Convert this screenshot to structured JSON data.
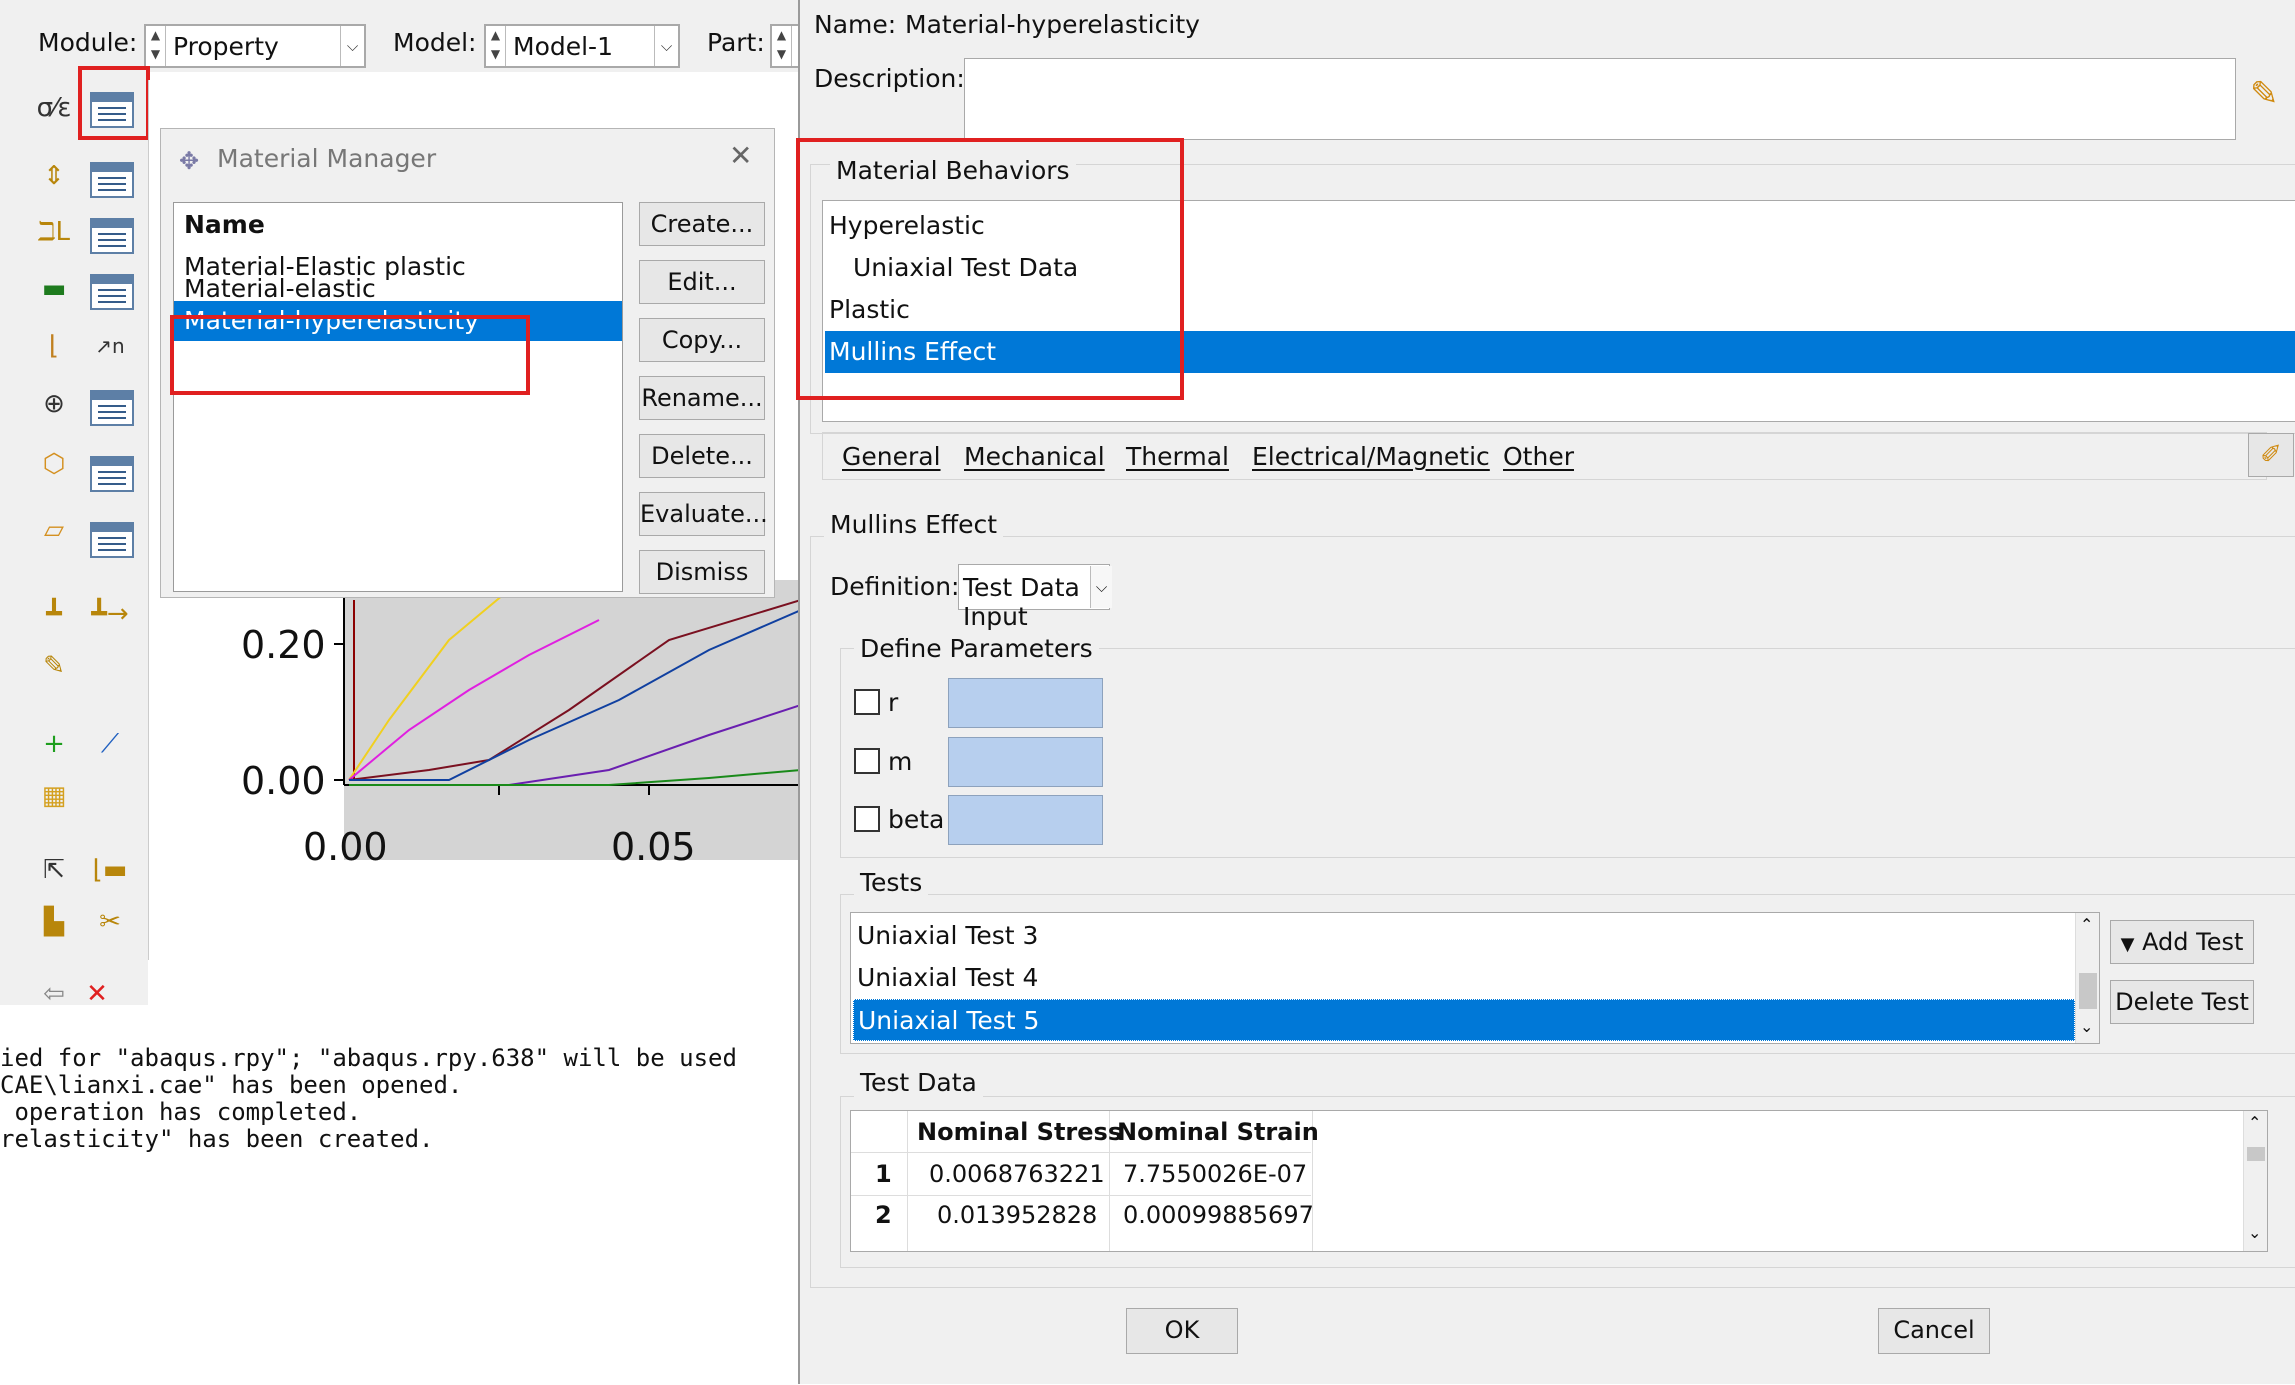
{
  "main": {
    "module_label": "Module:",
    "module_value": "Property",
    "model_label": "Model:",
    "model_value": "Model-1",
    "part_label": "Part:",
    "plot": {
      "y_ticks": [
        "0.20",
        "0.00"
      ],
      "x_ticks": [
        "0.00",
        "0.05"
      ]
    },
    "messages": [
      "ied for \"abaqus.rpy\"; \"abaqus.rpy.638\" will be used",
      "CAE\\lianxi.cae\" has been opened.",
      " operation has completed.",
      "relasticity\" has been created."
    ]
  },
  "material_manager": {
    "title": "Material Manager",
    "column_header": "Name",
    "materials": [
      "Material-Elastic plastic",
      "Material-elastic",
      "Material-hyperelasticity"
    ],
    "selected_index": 2,
    "buttons": {
      "create": "Create...",
      "edit": "Edit...",
      "copy": "Copy...",
      "rename": "Rename...",
      "delete": "Delete...",
      "evaluate": "Evaluate...",
      "dismiss": "Dismiss"
    }
  },
  "edit_material": {
    "name_label": "Name:",
    "name_value": "Material-hyperelasticity",
    "description_label": "Description:",
    "behaviors_title": "Material Behaviors",
    "behaviors": [
      "Hyperelastic",
      "Uniaxial Test Data",
      "Plastic",
      "Mullins Effect"
    ],
    "selected_behavior_index": 3,
    "menu_tabs": [
      "General",
      "Mechanical",
      "Thermal",
      "Electrical/Magnetic",
      "Other"
    ],
    "section_title": "Mullins Effect",
    "definition_label": "Definition:",
    "definition_value": "Test Data Input",
    "define_parameters_title": "Define Parameters",
    "parameters": [
      "r",
      "m",
      "beta"
    ],
    "tests_title": "Tests",
    "tests": [
      "Uniaxial Test 3",
      "Uniaxial Test 4",
      "Uniaxial Test 5"
    ],
    "selected_test_index": 2,
    "add_test_label": "Add Test",
    "delete_test_label": "Delete Test",
    "test_data_title": "Test Data",
    "table": {
      "headers": [
        "Nominal Stress",
        "Nominal Strain"
      ],
      "rows": [
        {
          "index": "1",
          "stress": "0.0068763221",
          "strain": "7.7550026E-07"
        },
        {
          "index": "2",
          "stress": "0.013952828",
          "strain": "0.00099885697"
        }
      ]
    },
    "ok_label": "OK",
    "cancel_label": "Cancel"
  }
}
